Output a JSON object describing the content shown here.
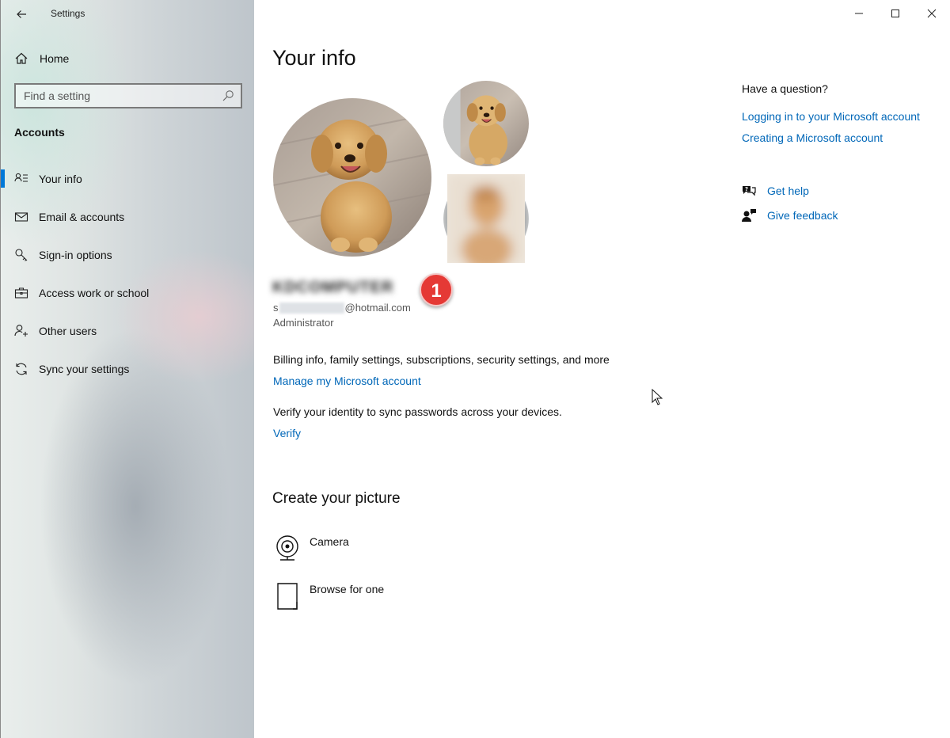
{
  "window": {
    "title": "Settings",
    "controls": [
      "minimize",
      "maximize",
      "close"
    ]
  },
  "sidebar": {
    "home_label": "Home",
    "search_placeholder": "Find a setting",
    "section_title": "Accounts",
    "items": [
      {
        "label": "Your info",
        "icon": "person-list-icon",
        "active": true
      },
      {
        "label": "Email & accounts",
        "icon": "mail-icon",
        "active": false
      },
      {
        "label": "Sign-in options",
        "icon": "key-icon",
        "active": false
      },
      {
        "label": "Access work or school",
        "icon": "briefcase-icon",
        "active": false
      },
      {
        "label": "Other users",
        "icon": "person-add-icon",
        "active": false
      },
      {
        "label": "Sync your settings",
        "icon": "sync-icon",
        "active": false
      }
    ]
  },
  "main": {
    "title": "Your info",
    "user_name": "KDCOMPUTER",
    "email_prefix": "s",
    "email_domain": "@hotmail.com",
    "role": "Administrator",
    "badge": "1",
    "billing_text": "Billing info, family settings, subscriptions, security settings, and more",
    "manage_link": "Manage my Microsoft account",
    "verify_text": "Verify your identity to sync passwords across your devices.",
    "verify_link": "Verify",
    "create_title": "Create your picture",
    "camera_label": "Camera",
    "browse_label": "Browse for one"
  },
  "right_panel": {
    "question": "Have a question?",
    "links": [
      "Logging in to your Microsoft account",
      "Creating a Microsoft account"
    ],
    "get_help": "Get help",
    "give_feedback": "Give feedback"
  },
  "colors": {
    "accent": "#0078d7",
    "link": "#0067b8",
    "badge": "#e53935"
  }
}
